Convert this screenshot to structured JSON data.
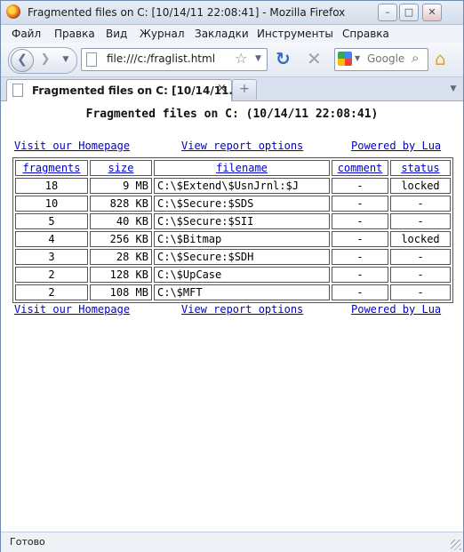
{
  "window": {
    "title": "Fragmented files on C: [10/14/11 22:08:41] - Mozilla Firefox",
    "min_glyph": "–",
    "max_glyph": "□",
    "close_glyph": "✕"
  },
  "menu": [
    {
      "label": "Файл"
    },
    {
      "label": "Правка"
    },
    {
      "label": "Вид"
    },
    {
      "label": "Журнал"
    },
    {
      "label": "Закладки"
    },
    {
      "label": "Инструменты"
    },
    {
      "label": "Справка"
    }
  ],
  "nav": {
    "url": "file:///c:/fraglist.html",
    "search_placeholder": "Google"
  },
  "tab": {
    "title": "Fragmented files on C: [10/14/11...",
    "close": "×",
    "new_tab": "+"
  },
  "page": {
    "title": "Fragmented files on C: (10/14/11 22:08:41)",
    "links": {
      "homepage": "Visit our Homepage",
      "options": "View report options",
      "powered": "Powered by Lua"
    },
    "table": {
      "headers": [
        "fragments",
        "size",
        "filename",
        "comment",
        "status"
      ],
      "rows": [
        {
          "fragments": "18",
          "size": "9 MB",
          "filename": "C:\\$Extend\\$UsnJrnl:$J",
          "comment": "-",
          "status": "locked"
        },
        {
          "fragments": "10",
          "size": "828 KB",
          "filename": "C:\\$Secure:$SDS",
          "comment": "-",
          "status": "-"
        },
        {
          "fragments": "5",
          "size": "40 KB",
          "filename": "C:\\$Secure:$SII",
          "comment": "-",
          "status": "-"
        },
        {
          "fragments": "4",
          "size": "256 KB",
          "filename": "C:\\$Bitmap",
          "comment": "-",
          "status": "locked"
        },
        {
          "fragments": "3",
          "size": "28 KB",
          "filename": "C:\\$Secure:$SDH",
          "comment": "-",
          "status": "-"
        },
        {
          "fragments": "2",
          "size": "128 KB",
          "filename": "C:\\$UpCase",
          "comment": "-",
          "status": "-"
        },
        {
          "fragments": "2",
          "size": "108 MB",
          "filename": "C:\\$MFT",
          "comment": "-",
          "status": "-"
        }
      ]
    }
  },
  "status": {
    "text": "Готово"
  }
}
